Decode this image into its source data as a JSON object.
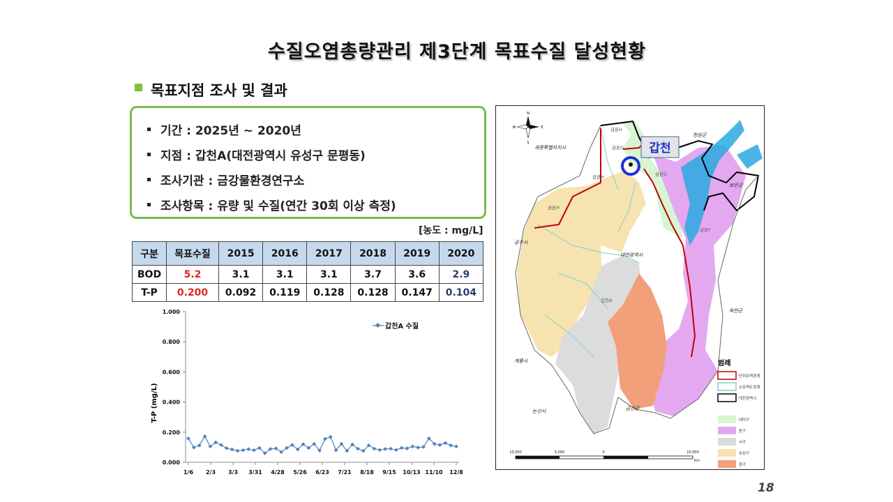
{
  "title": "수질오염총량관리  제3단계  목표수질  달성현황",
  "subtitle": "목표지점 조사 및 결과",
  "info": [
    "기간 : 2025년 ~ 2020년",
    "지점 : 갑천A(대전광역시 유성구 문평동)",
    "조사기관 : 금강물환경연구소",
    "조사항목 : 유량 및 수질(연간 30회 이상 측정)"
  ],
  "unit_note": "[농도 : mg/L]",
  "table": {
    "headers": [
      "구분",
      "목표수질",
      "2015",
      "2016",
      "2017",
      "2018",
      "2019",
      "2020"
    ],
    "rows": [
      {
        "label": "BOD",
        "values": [
          "5.2",
          "3.1",
          "3.1",
          "3.1",
          "3.7",
          "3.6",
          "2.9"
        ]
      },
      {
        "label": "T-P",
        "values": [
          "0.200",
          "0.092",
          "0.119",
          "0.128",
          "0.128",
          "0.147",
          "0.104"
        ]
      }
    ],
    "target_color": "#e0241d",
    "latest_color": "#27406f"
  },
  "chart_data": {
    "type": "line",
    "ylabel": "T-P (mg/L)",
    "ylim": [
      0,
      1
    ],
    "yticks": [
      "0.000",
      "0.200",
      "0.400",
      "0.600",
      "0.800",
      "1.000"
    ],
    "xticks": [
      "1/6",
      "2/3",
      "3/3",
      "3/31",
      "4/28",
      "5/26",
      "6/23",
      "7/21",
      "8/18",
      "9/15",
      "10/13",
      "11/10",
      "12/8"
    ],
    "series": [
      {
        "name": "갑천A 수질",
        "color": "#4f81bd",
        "values": [
          0.158,
          0.098,
          0.112,
          0.172,
          0.105,
          0.132,
          0.115,
          0.093,
          0.085,
          0.076,
          0.08,
          0.087,
          0.08,
          0.095,
          0.06,
          0.088,
          0.092,
          0.068,
          0.095,
          0.115,
          0.085,
          0.12,
          0.095,
          0.122,
          0.078,
          0.155,
          0.168,
          0.08,
          0.122,
          0.076,
          0.118,
          0.09,
          0.075,
          0.112,
          0.09,
          0.082,
          0.088,
          0.09,
          0.082,
          0.095,
          0.092,
          0.105,
          0.098,
          0.102,
          0.158,
          0.122,
          0.115,
          0.128,
          0.112,
          0.105
        ]
      }
    ],
    "legend": "top-right",
    "grid": false
  },
  "map": {
    "station_label": "갑천",
    "station_color": "#1d2fd6",
    "place_labels": [
      "세종특별자치시",
      "청원군",
      "보은군",
      "공주시",
      "대전광역시",
      "옥천군",
      "계룡시",
      "논산시",
      "금산군"
    ],
    "basin_labels": [
      "금본H",
      "금본G",
      "금본H",
      "금본G",
      "금본H",
      "금본F",
      "갑천A"
    ],
    "legend_title": "범례",
    "legend_lines": [
      {
        "label": "단위유역경계",
        "color": "#c00000"
      },
      {
        "label": "소유역도경계",
        "color": "#7fd0c8"
      },
      {
        "label": "대전광역시",
        "color": "#000000"
      }
    ],
    "legend_areas": [
      {
        "label": "대덕구",
        "color": "#d6f5d2"
      },
      {
        "label": "동구",
        "color": "#e3a8f0"
      },
      {
        "label": "서구",
        "color": "#dcdcdc"
      },
      {
        "label": "유성구",
        "color": "#f6e3b0"
      },
      {
        "label": "중구",
        "color": "#f2a07a"
      }
    ],
    "scale_labels": [
      "10,000",
      "5,000",
      "0",
      "10,000"
    ],
    "scale_unit": "Km"
  },
  "page_number": "18"
}
